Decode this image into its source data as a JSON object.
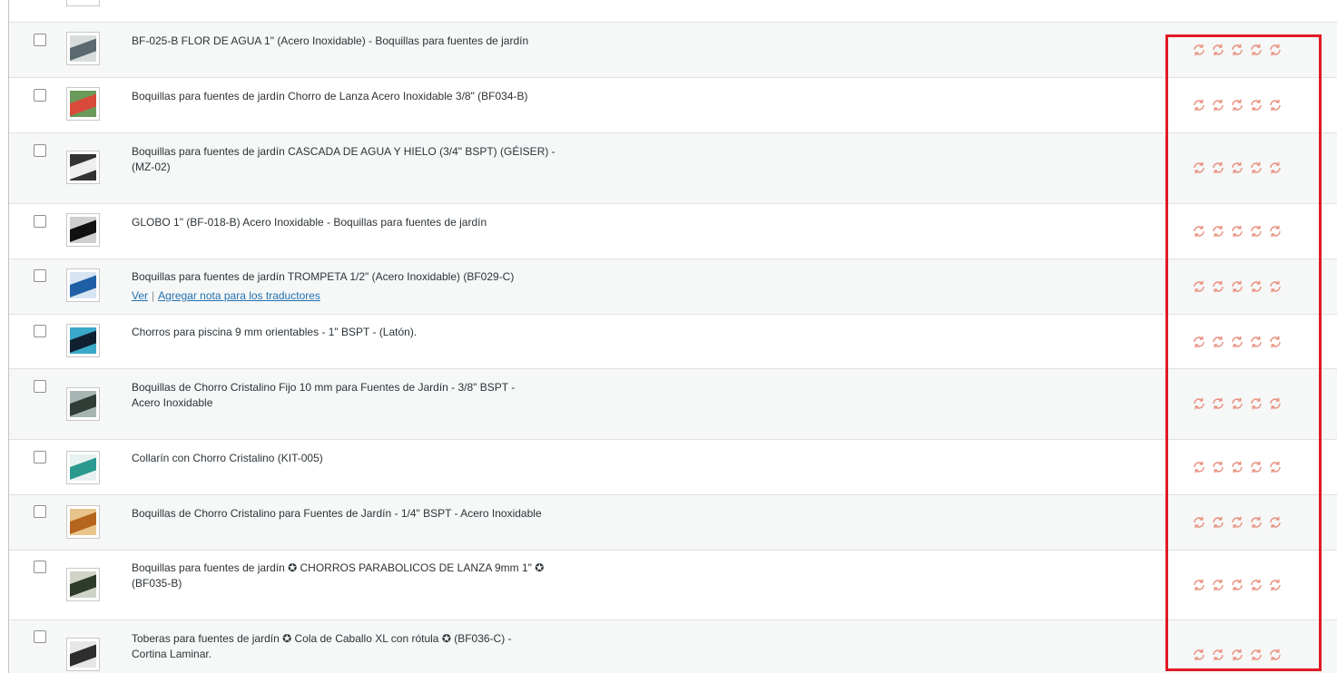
{
  "products": [
    {
      "title": "BF-025-B FLOR DE AGUA 1\" (Acero Inoxidable) - Boquillas para fuentes de jardín",
      "thumb_colors": [
        "#5a6a70",
        "#d9dcdc"
      ]
    },
    {
      "title": "Boquillas para fuentes de jardín Chorro de Lanza Acero Inoxidable 3/8\" (BF034-B)",
      "thumb_colors": [
        "#d94a3a",
        "#6a9a5a"
      ]
    },
    {
      "title": "Boquillas para fuentes de jardín CASCADA DE AGUA Y HIELO (3/4\" BSPT) (GÉISER) - (MZ-02)",
      "thumb_colors": [
        "#eeeeee",
        "#333333"
      ]
    },
    {
      "title": "GLOBO 1\" (BF-018-B) Acero Inoxidable - Boquillas para fuentes de jardín",
      "thumb_colors": [
        "#111111",
        "#cfcfcf"
      ]
    },
    {
      "title": "Boquillas para fuentes de jardín TROMPETA 1/2\" (Acero Inoxidable) (BF029-C)",
      "thumb_colors": [
        "#1f5fa6",
        "#d7e4f2"
      ],
      "actions": {
        "view": "Ver",
        "note": "Agregar nota para los traductores"
      }
    },
    {
      "title": "Chorros para piscina 9 mm orientables - 1\" BSPT - (Latón).",
      "thumb_colors": [
        "#102030",
        "#3aa8c8"
      ]
    },
    {
      "title": "Boquillas de Chorro Cristalino Fijo 10 mm para Fuentes de Jardín - 3/8\" BSPT - Acero Inoxidable",
      "thumb_colors": [
        "#2f3d36",
        "#a7b6b2"
      ]
    },
    {
      "title": "Collarín con Chorro Cristalino (KIT-005)",
      "thumb_colors": [
        "#2a9a8f",
        "#e7f2f0"
      ]
    },
    {
      "title": "Boquillas de Chorro Cristalino para Fuentes de Jardín - 1/4\" BSPT - Acero Inoxidable",
      "thumb_colors": [
        "#b5651d",
        "#e9c48a"
      ]
    },
    {
      "title": "Boquillas para fuentes de jardín ✪ CHORROS PARABOLICOS DE LANZA 9mm 1\" ✪ (BF035-B)",
      "thumb_colors": [
        "#2e3a2a",
        "#cfd3c8"
      ]
    },
    {
      "title": "Toberas para fuentes de jardín ✪ Cola de Caballo XL con rótula ✪ (BF036-C) - Cortina Laminar.",
      "thumb_colors": [
        "#2d2d2d",
        "#e6e6e6"
      ]
    }
  ],
  "status_icon": "translation-sync-icon",
  "status_icon_color": "#e8907e",
  "highlight_color": "#e01b24"
}
